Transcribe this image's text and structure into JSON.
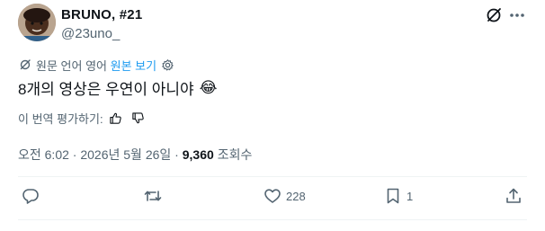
{
  "author": {
    "display_name": "BRUNO, #21",
    "handle": "@23uno_"
  },
  "translate": {
    "prefix": "원문 언어 영어",
    "link_label": "원본 보기"
  },
  "tweet": {
    "text": "8개의 영상은 우연이 아니야",
    "emoji": "😂"
  },
  "rate_translation": {
    "label": "이 번역 평가하기:"
  },
  "meta": {
    "time": "오전 6:02",
    "separator": " · ",
    "date": "2026년 5월 26일",
    "views_count": "9,360",
    "views_label": "조회수"
  },
  "actions": {
    "likes": "228",
    "bookmarks": "1"
  },
  "colors": {
    "text": "#0f1419",
    "secondary": "#536471",
    "link": "#1d9bf0",
    "divider": "#eff3f4"
  }
}
